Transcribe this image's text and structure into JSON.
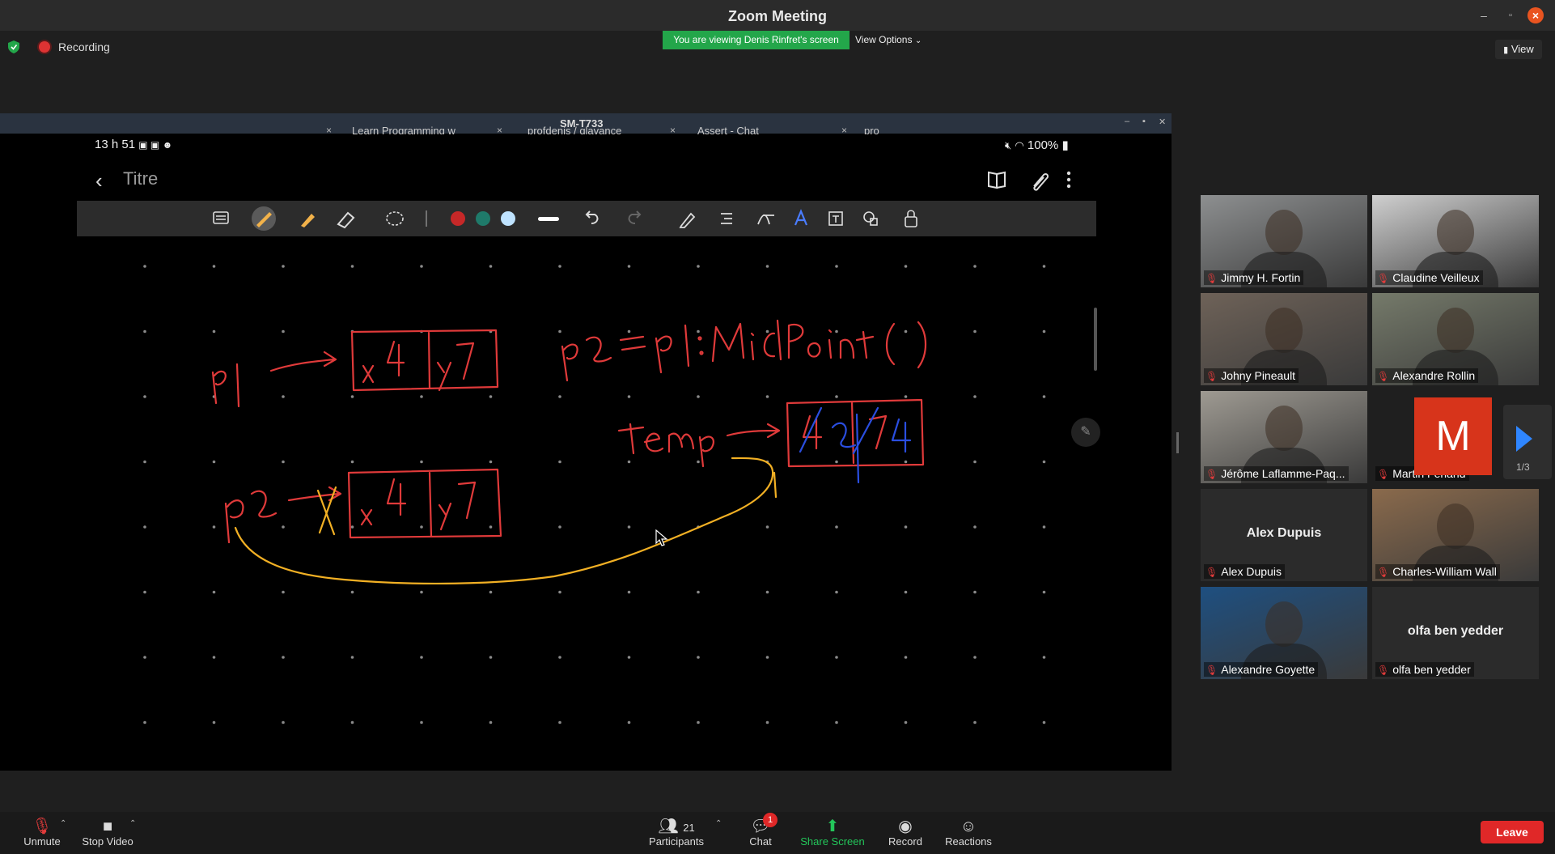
{
  "window": {
    "title": "Zoom Meeting"
  },
  "header": {
    "recording_label": "Recording",
    "viewing_banner": "You are viewing Denis Rinfret's screen",
    "view_options_label": "View Options",
    "view_label": "View"
  },
  "shared": {
    "device_name": "SM-T733",
    "tabs": [
      "Learn Programming w",
      "profdenis / qlavance",
      "Assert - Chat",
      "pro"
    ],
    "status_time": "13 h 51",
    "battery": "100%",
    "note_title": "Titre",
    "pen_colors": [
      "#c62828",
      "#1f7a6a",
      "#bfe3ff"
    ],
    "ink": {
      "label_p1": "p1",
      "label_p2": "p2",
      "label_temp": "temp",
      "equation": "p2 = p1:MidPoint( )",
      "box1_x": "x 4",
      "box1_y": "y7",
      "box2_x": "x 4",
      "box2_y": "y7",
      "temp_x": "4 2",
      "temp_y": "7 4"
    }
  },
  "participants": [
    {
      "name": "Jimmy H. Fortin",
      "video": true,
      "bg": "#8d8f90"
    },
    {
      "name": "Claudine Veilleux",
      "video": true,
      "bg": "#cfcfcf"
    },
    {
      "name": "Johny Pineault",
      "video": true,
      "bg": "#6e6258"
    },
    {
      "name": "Alexandre Rollin",
      "video": true,
      "bg": "#757a6a"
    },
    {
      "name": "Jérôme Laflamme-Paq...",
      "video": true,
      "bg": "#9e9a92"
    },
    {
      "name": "Martin Ferland",
      "video": false,
      "avatar_letter": "M"
    },
    {
      "name": "Alex Dupuis",
      "video": false,
      "display": "Alex Dupuis"
    },
    {
      "name": "Charles-William Wall",
      "video": true,
      "bg": "#8a6a4c"
    },
    {
      "name": "Alexandre Goyette",
      "video": true,
      "bg": "#1e4f80"
    },
    {
      "name": "olfa ben yedder",
      "video": false,
      "display": "olfa ben yedder"
    }
  ],
  "gallery": {
    "page": "1/3"
  },
  "bottom": {
    "unmute": "Unmute",
    "stop_video": "Stop Video",
    "participants_label": "Participants",
    "participants_count": "21",
    "chat_label": "Chat",
    "chat_badge": "1",
    "share_label": "Share Screen",
    "record_label": "Record",
    "reactions_label": "Reactions",
    "leave_label": "Leave"
  }
}
